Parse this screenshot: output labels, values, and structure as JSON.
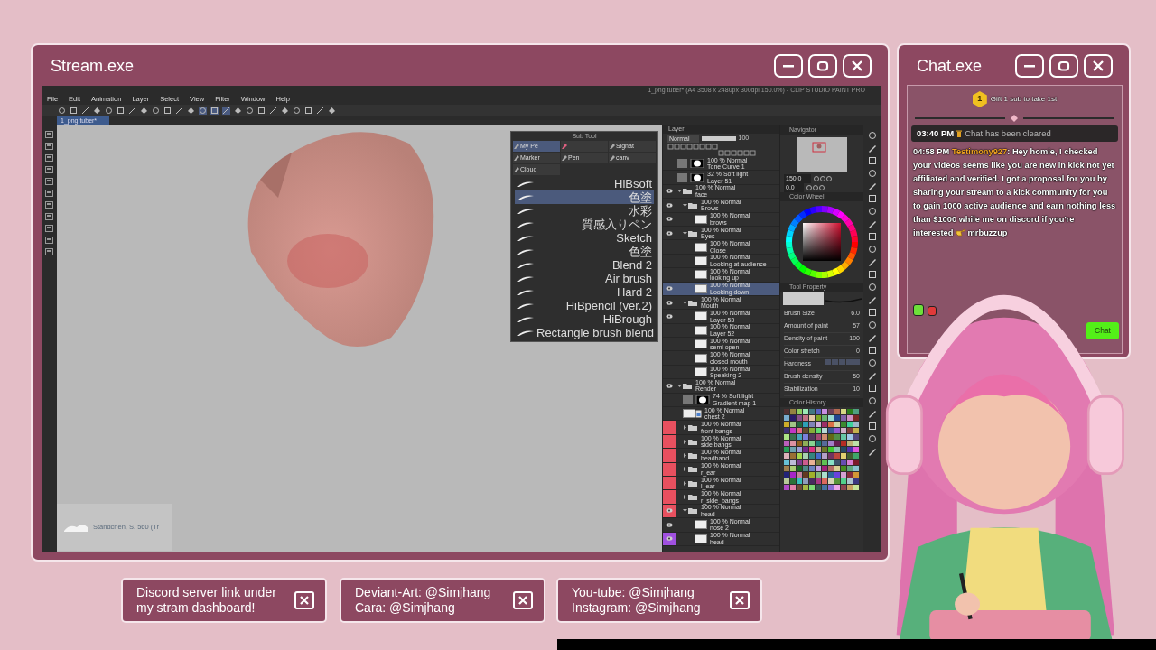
{
  "stream_window": {
    "title": "Stream.exe",
    "app": {
      "title": "1_png tuber* (A4 3508 x 2480px 300dpi 150.0%) - CLIP STUDIO PAINT PRO",
      "menu": [
        "File",
        "Edit",
        "Animation",
        "Layer",
        "Select",
        "View",
        "Filter",
        "Window",
        "Help"
      ],
      "tab": "1_png tuber*",
      "now_playing": "Ständchen, S. 560 (Tr",
      "sub_tool": {
        "title": "Sub Tool",
        "groups": [
          {
            "label": "My Pe",
            "selected": true
          },
          {
            "selected": false
          },
          {
            "label": "Signat",
            "selected": false
          },
          {
            "label": "Marker",
            "selected": false
          },
          {
            "label": "Pen",
            "selected": false
          },
          {
            "label": "canv",
            "selected": false
          },
          {
            "label": "Cloud",
            "selected": false
          }
        ],
        "brushes": [
          {
            "name": "HiBsoft",
            "selected": false
          },
          {
            "name": "色塗",
            "selected": true
          },
          {
            "name": "水彩",
            "selected": false
          },
          {
            "name": "質感入りペン",
            "selected": false
          },
          {
            "name": "Sketch",
            "selected": false
          },
          {
            "name": "色塗",
            "selected": false
          },
          {
            "name": "Blend 2",
            "selected": false
          },
          {
            "name": "Air brush",
            "selected": false
          },
          {
            "name": "Hard 2",
            "selected": false
          },
          {
            "name": "HiBpencil (ver.2)",
            "selected": false
          },
          {
            "name": "HiBrough",
            "selected": false
          },
          {
            "name": "Rectangle brush blend",
            "selected": false
          }
        ]
      },
      "layers": {
        "title": "Layer",
        "blend_mode": "Normal",
        "opacity": "100",
        "level": 1,
        "items": [
          {
            "kind": "mask",
            "mode": "100 % Normal",
            "name": "Tone Curve 1",
            "visible": false,
            "selected": false
          },
          {
            "kind": "mask",
            "mode": "32 % Soft light",
            "name": "Layer 51",
            "visible": false,
            "selected": false
          },
          {
            "kind": "folder",
            "mode": "100 % Normal",
            "name": "face",
            "visible": true,
            "selected": false,
            "expanded": true,
            "children": [
              {
                "kind": "folder",
                "mode": "100 % Normal",
                "name": "Brows",
                "visible": true,
                "selected": false,
                "expanded": true,
                "children": [
                  {
                    "kind": "raster",
                    "mode": "100 % Normal",
                    "name": "brows",
                    "visible": true,
                    "selected": false
                  }
                ]
              },
              {
                "kind": "folder",
                "mode": "100 % Normal",
                "name": "Eyes",
                "visible": true,
                "selected": false,
                "expanded": true,
                "children": [
                  {
                    "kind": "raster",
                    "mode": "100 % Normal",
                    "name": "Close",
                    "visible": false,
                    "selected": false
                  },
                  {
                    "kind": "raster",
                    "mode": "100 % Normal",
                    "name": "Looking at audience",
                    "visible": false,
                    "selected": false
                  },
                  {
                    "kind": "raster",
                    "mode": "100 % Normal",
                    "name": "looking up",
                    "visible": false,
                    "selected": false
                  },
                  {
                    "kind": "raster",
                    "mode": "100 % Normal",
                    "name": "Looking down",
                    "visible": true,
                    "selected": true
                  }
                ]
              },
              {
                "kind": "folder",
                "mode": "100 % Normal",
                "name": "Mouth",
                "visible": true,
                "selected": false,
                "expanded": true,
                "children": [
                  {
                    "kind": "raster",
                    "mode": "100 % Normal",
                    "name": "Layer 53",
                    "visible": true,
                    "selected": false
                  },
                  {
                    "kind": "raster",
                    "mode": "100 % Normal",
                    "name": "Layer 52",
                    "visible": false,
                    "selected": false
                  },
                  {
                    "kind": "raster",
                    "mode": "100 % Normal",
                    "name": "semi open",
                    "visible": false,
                    "selected": false
                  },
                  {
                    "kind": "raster",
                    "mode": "100 % Normal",
                    "name": "closed mouth",
                    "visible": false,
                    "selected": false
                  },
                  {
                    "kind": "raster",
                    "mode": "100 % Normal",
                    "name": "Speaking 2",
                    "visible": false,
                    "selected": false
                  }
                ]
              }
            ]
          },
          {
            "kind": "folder",
            "mode": "100 % Normal",
            "name": "Render",
            "visible": true,
            "selected": false,
            "expanded": true,
            "children": [
              {
                "kind": "mask",
                "mode": "74 % Soft light",
                "name": "Gradient map 1",
                "visible": false,
                "selected": false
              },
              {
                "kind": "linked",
                "mode": "100 % Normal",
                "name": "chest 2",
                "visible": false,
                "selected": false
              },
              {
                "kind": "folder",
                "mode": "100 % Normal",
                "name": "front bangs",
                "visible": false,
                "selected": false,
                "expanded": false,
                "color": "#e8505f"
              },
              {
                "kind": "folder",
                "mode": "100 % Normal",
                "name": "side bangs",
                "visible": false,
                "selected": false,
                "expanded": false,
                "color": "#e8505f"
              },
              {
                "kind": "folder",
                "mode": "100 % Normal",
                "name": "headband",
                "visible": false,
                "selected": false,
                "expanded": false,
                "color": "#e8505f"
              },
              {
                "kind": "folder",
                "mode": "100 % Normal",
                "name": "r_ear",
                "visible": false,
                "selected": false,
                "expanded": false,
                "color": "#e8505f"
              },
              {
                "kind": "folder",
                "mode": "100 % Normal",
                "name": "l_ear",
                "visible": false,
                "selected": false,
                "expanded": false,
                "color": "#e8505f"
              },
              {
                "kind": "folder",
                "mode": "100 % Normal",
                "name": "r_side_bangs",
                "visible": false,
                "selected": false,
                "expanded": false,
                "color": "#e8505f"
              },
              {
                "kind": "folder",
                "mode": "100 % Normal",
                "name": "head",
                "visible": true,
                "selected": false,
                "expanded": true,
                "color": "#e8505f",
                "children": [
                  {
                    "kind": "raster",
                    "mode": "100 % Normal",
                    "name": "nose 2",
                    "visible": true,
                    "selected": false
                  },
                  {
                    "kind": "raster",
                    "mode": "100 % Normal",
                    "name": "head",
                    "visible": true,
                    "selected": false,
                    "color": "#a050e0"
                  }
                ]
              }
            ]
          }
        ]
      },
      "navigator": {
        "title": "Navigator",
        "zoom": "150.0",
        "angle": "0.0"
      },
      "color_wheel": {
        "title": "Color Wheel"
      },
      "tool_property": {
        "title": "Tool Property",
        "items": [
          {
            "kind": "value",
            "label": "Brush Size",
            "value": "6.0"
          },
          {
            "kind": "value",
            "label": "Amount of paint",
            "value": "57"
          },
          {
            "kind": "value",
            "label": "Density of paint",
            "value": "100"
          },
          {
            "kind": "value",
            "label": "Color stretch",
            "value": "0"
          },
          {
            "kind": "segments",
            "label": "Hardness"
          },
          {
            "kind": "value",
            "label": "Brush density",
            "value": "50"
          },
          {
            "kind": "value",
            "label": "Stabilization",
            "value": "10"
          }
        ]
      },
      "color_history": {
        "title": "Color History"
      }
    }
  },
  "chat_window": {
    "title": "Chat.exe",
    "goal": {
      "rank": "1",
      "text": "Gift 1 sub to take 1st"
    },
    "messages": [
      {
        "kind": "system",
        "time": "03:40 PM",
        "text": "Chat has been cleared"
      },
      {
        "kind": "user",
        "time": "04:58 PM",
        "user": "Testimony927",
        "text": ": Hey homie, I checked your videos seems like you are new in kick not yet affiliated and verified. I got a proposal for you by sharing your stream to a kick community for you to gain 1000 active audience and earn nothing less than $1000 while me on discord if you're interested",
        "mention": "mrbuzzup"
      }
    ],
    "send_label": "Chat"
  },
  "banners": [
    {
      "lines": [
        "Discord server link under",
        "my stram dashboard!"
      ]
    },
    {
      "lines": [
        "Deviant-Art: @Simjhang",
        "Cara: @Simjhang"
      ]
    },
    {
      "lines": [
        "You-tube: @Simjhang",
        "Instagram: @Simjhang"
      ]
    }
  ]
}
